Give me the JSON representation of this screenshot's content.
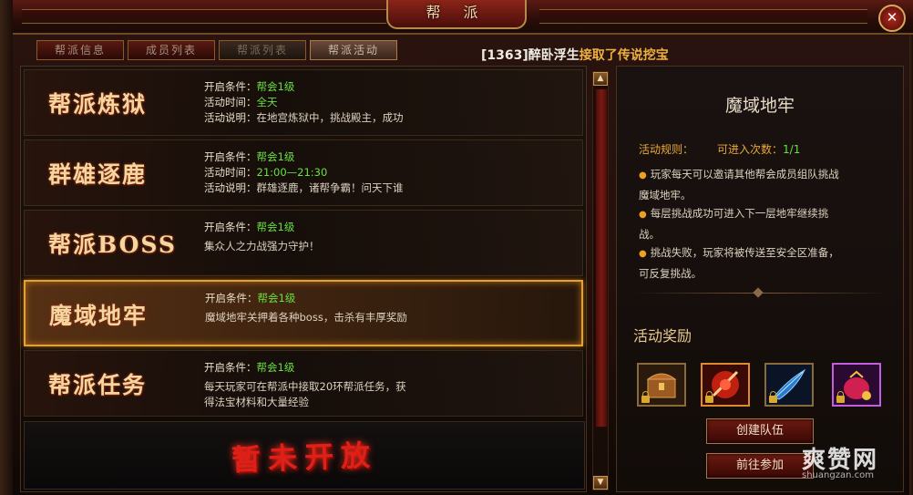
{
  "window": {
    "title": "帮 派",
    "close_label": "✕"
  },
  "tabs": [
    {
      "label": "帮派信息"
    },
    {
      "label": "成员列表"
    },
    {
      "label": "帮派列表"
    },
    {
      "label": "帮派活动"
    }
  ],
  "announcement": {
    "player": "[1363]醉卧浮生",
    "action": "接取了传说挖宝"
  },
  "activities": [
    {
      "name": "帮派炼狱",
      "open_label": "开启条件：",
      "open_value": "帮会1级",
      "time_label": "活动时间：",
      "time_value": "全天",
      "desc_label": "活动说明：",
      "desc": "在地宫炼狱中，挑战殿主，成功"
    },
    {
      "name": "群雄逐鹿",
      "open_label": "开启条件：",
      "open_value": "帮会1级",
      "time_label": "活动时间：",
      "time_value": "21:00—21:30",
      "desc_label": "活动说明：",
      "desc": "群雄逐鹿，诸帮争霸！问天下谁"
    },
    {
      "name": "帮派BOSS",
      "open_label": "开启条件：",
      "open_value": "帮会1级",
      "desc": "集众人之力战强力守护！"
    },
    {
      "name": "魔域地牢",
      "open_label": "开启条件：",
      "open_value": "帮会1级",
      "desc": "魔域地牢关押着各种boss，击杀有丰厚奖励"
    },
    {
      "name": "帮派任务",
      "open_label": "开启条件：",
      "open_value": "帮会1级",
      "desc_line1": "每天玩家可在帮派中接取20环帮派任务，获",
      "desc_line2": "得法宝材料和大量经验"
    }
  ],
  "locked_slot": {
    "text": "暂未开放"
  },
  "scrollbar": {
    "up": "▲",
    "down": "▼"
  },
  "detail": {
    "title": "魔域地牢",
    "rules_label": "活动规则：",
    "entries_label": "可进入次数：",
    "entries_value": "1/1",
    "rules": [
      [
        "玩家每天可以邀请其他帮会成员组队挑战",
        "魔域地牢。"
      ],
      [
        "每层挑战成功可进入下一层地牢继续挑",
        "战。"
      ],
      [
        "挑战失败，玩家将被传送至安全区准备，",
        "可反复挑战。"
      ]
    ],
    "reward_title": "活动奖励",
    "rewards": [
      {
        "icon": "treasure-chest-icon"
      },
      {
        "icon": "red-claw-icon"
      },
      {
        "icon": "blue-feather-icon"
      },
      {
        "icon": "purple-pouch-icon"
      }
    ],
    "create_team": "创建队伍",
    "join": "前往参加"
  },
  "watermark": {
    "main": "爽赞网",
    "sub": "shuangzan.com"
  }
}
